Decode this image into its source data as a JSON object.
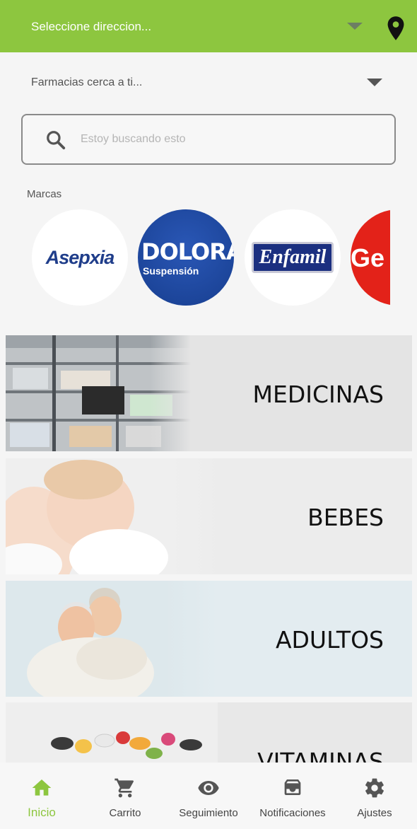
{
  "header": {
    "address_placeholder": "Seleccione direccion...",
    "dropdown_icon": "caret-down-icon",
    "location_icon": "map-pin-icon",
    "color": "#8dc63f"
  },
  "pharmacy_selector": {
    "label": "Farmacias cerca a ti...",
    "dropdown_icon": "caret-down-icon"
  },
  "search": {
    "placeholder": "Estoy buscando esto",
    "icon": "search-icon"
  },
  "brands": {
    "label": "Marcas",
    "items": [
      {
        "name": "Asepxia"
      },
      {
        "name": "DOLORAL",
        "subtitle": "Suspensión"
      },
      {
        "name": "Enfamil"
      },
      {
        "name": "Ge"
      }
    ]
  },
  "categories": [
    {
      "label": "MEDICINAS"
    },
    {
      "label": "BEBES"
    },
    {
      "label": "ADULTOS"
    },
    {
      "label": "VITAMINAS"
    }
  ],
  "bottom_nav": {
    "active_color": "#8dc63f",
    "items": [
      {
        "label": "Inicio",
        "icon": "home-icon"
      },
      {
        "label": "Carrito",
        "icon": "cart-icon"
      },
      {
        "label": "Seguimiento",
        "icon": "eye-icon"
      },
      {
        "label": "Notificaciones",
        "icon": "inbox-icon"
      },
      {
        "label": "Ajustes",
        "icon": "gear-icon"
      }
    ]
  }
}
